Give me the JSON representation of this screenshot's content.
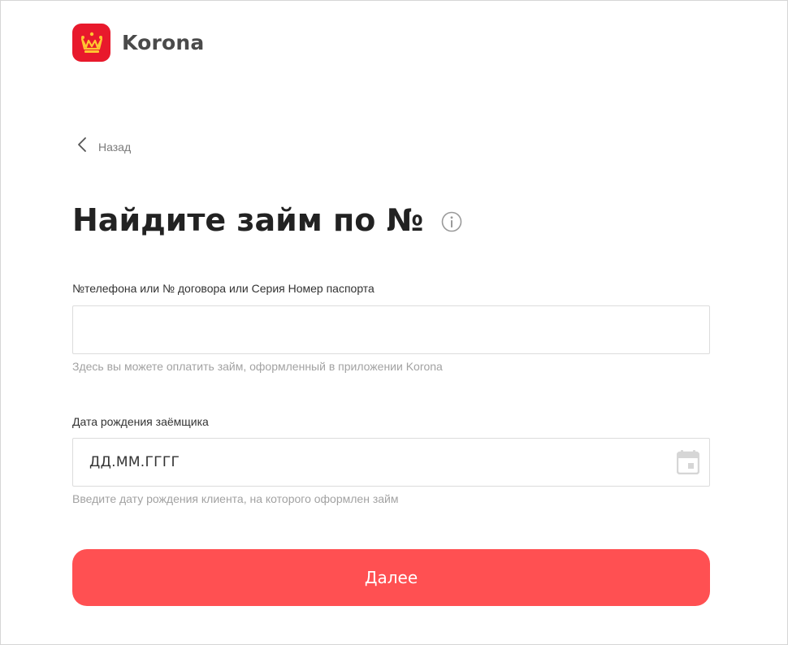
{
  "brand": {
    "name": "Korona",
    "color": "#e8192c",
    "icon": "crown-icon"
  },
  "nav": {
    "back_label": "Назад",
    "back_icon": "chevron-left-icon"
  },
  "page": {
    "title": "Найдите займ по №",
    "info_icon": "info-icon"
  },
  "form": {
    "search": {
      "label": "№телефона или № договора или Серия Номер паспорта",
      "value": "",
      "placeholder": "",
      "hint": "Здесь вы можете оплатить займ, оформленный в приложении Korona"
    },
    "birthdate": {
      "label": "Дата рождения заёмщика",
      "value": "",
      "placeholder": "ДД.ММ.ГГГГ",
      "hint": "Введите дату рождения клиента, на которого оформлен займ",
      "icon": "calendar-icon"
    },
    "submit_label": "Далее",
    "submit_color": "#ff5052"
  }
}
